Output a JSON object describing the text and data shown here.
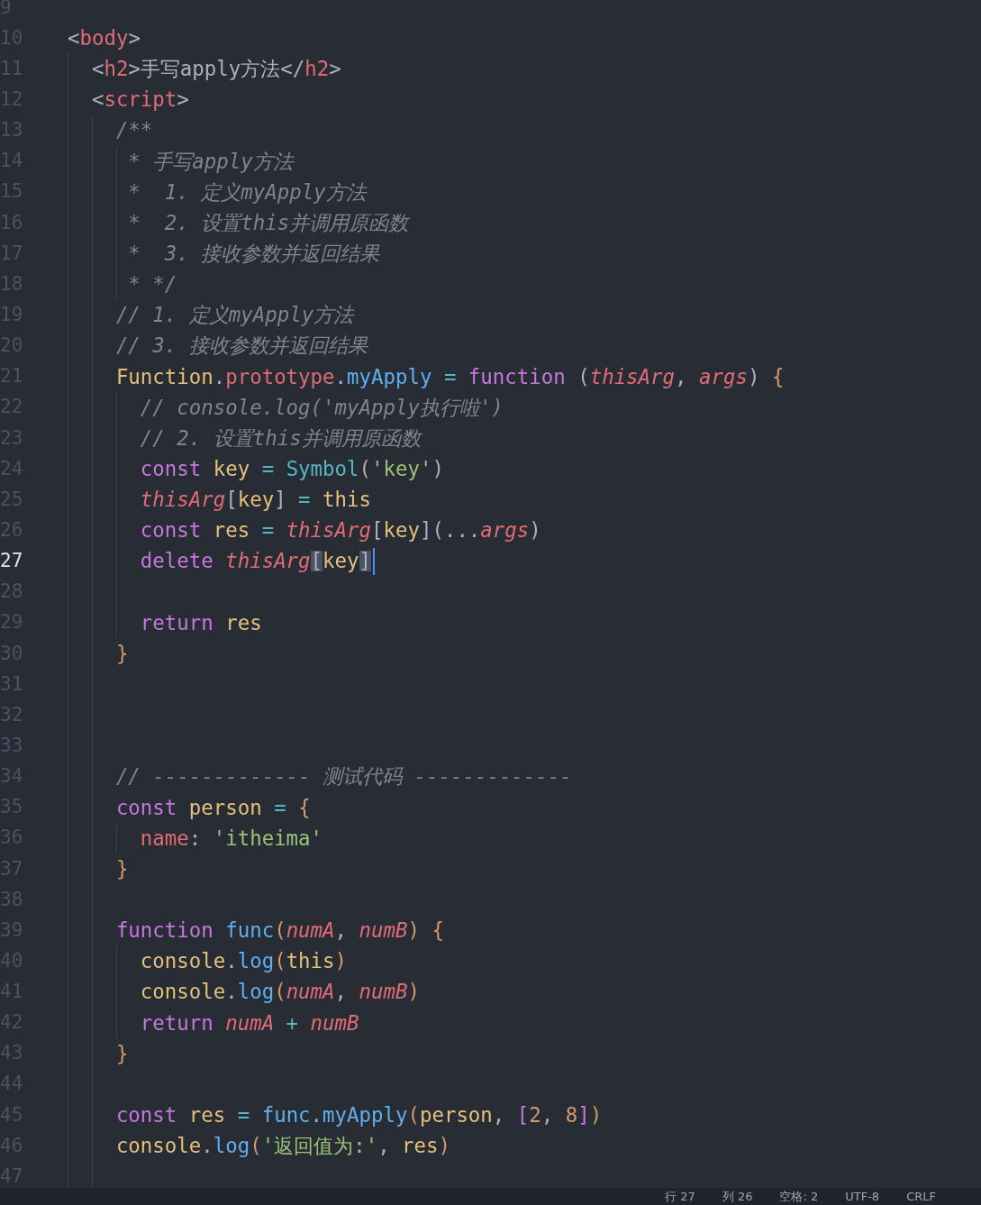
{
  "editor": {
    "lines": [
      {
        "number": "9",
        "current": false
      },
      {
        "number": "10",
        "current": false,
        "tokens": [
          {
            "text": "  <",
            "kind": "punct"
          },
          {
            "text": "body",
            "kind": "tag"
          },
          {
            "text": ">",
            "kind": "punct"
          }
        ]
      },
      {
        "number": "11",
        "current": false,
        "tokens": [
          {
            "text": "    <",
            "kind": "punct"
          },
          {
            "text": "h2",
            "kind": "tag"
          },
          {
            "text": ">",
            "kind": "punct"
          },
          {
            "text": "手写apply方法",
            "kind": "plain"
          },
          {
            "text": "</",
            "kind": "punct"
          },
          {
            "text": "h2",
            "kind": "tag"
          },
          {
            "text": ">",
            "kind": "punct"
          }
        ]
      },
      {
        "number": "12",
        "current": false,
        "tokens": [
          {
            "text": "    <",
            "kind": "punct"
          },
          {
            "text": "script",
            "kind": "tag"
          },
          {
            "text": ">",
            "kind": "punct"
          }
        ]
      },
      {
        "number": "13",
        "current": false,
        "tokens": [
          {
            "text": "      /**",
            "kind": "comment"
          }
        ]
      },
      {
        "number": "14",
        "current": false,
        "tokens": [
          {
            "text": "       * 手写apply方法",
            "kind": "comment"
          }
        ]
      },
      {
        "number": "15",
        "current": false,
        "tokens": [
          {
            "text": "       *  1. 定义myApply方法",
            "kind": "comment"
          }
        ]
      },
      {
        "number": "16",
        "current": false,
        "tokens": [
          {
            "text": "       *  2. 设置this并调用原函数",
            "kind": "comment"
          }
        ]
      },
      {
        "number": "17",
        "current": false,
        "tokens": [
          {
            "text": "       *  3. 接收参数并返回结果",
            "kind": "comment"
          }
        ]
      },
      {
        "number": "18",
        "current": false,
        "tokens": [
          {
            "text": "       * */",
            "kind": "comment"
          }
        ]
      },
      {
        "number": "19",
        "current": false,
        "tokens": [
          {
            "text": "      // 1. 定义myApply方法",
            "kind": "comment"
          }
        ]
      },
      {
        "number": "20",
        "current": false,
        "tokens": [
          {
            "text": "      // 3. 接收参数并返回结果",
            "kind": "comment"
          }
        ]
      },
      {
        "number": "21",
        "current": false,
        "tokens": [
          {
            "text": "      Function",
            "kind": "variable"
          },
          {
            "text": ".",
            "kind": "punct"
          },
          {
            "text": "prototype",
            "kind": "property"
          },
          {
            "text": ".",
            "kind": "punct"
          },
          {
            "text": "myApply",
            "kind": "function"
          },
          {
            "text": " = ",
            "kind": "operator"
          },
          {
            "text": "function",
            "kind": "keyword"
          },
          {
            "text": " (",
            "kind": "punct"
          },
          {
            "text": "thisArg",
            "kind": "param"
          },
          {
            "text": ", ",
            "kind": "punct"
          },
          {
            "text": "args",
            "kind": "param"
          },
          {
            "text": ") ",
            "kind": "punct"
          },
          {
            "text": "{",
            "kind": "bracket"
          }
        ]
      },
      {
        "number": "22",
        "current": false,
        "tokens": [
          {
            "text": "        // console.log('myApply执行啦')",
            "kind": "comment"
          }
        ]
      },
      {
        "number": "23",
        "current": false,
        "tokens": [
          {
            "text": "        // 2. 设置this并调用原函数",
            "kind": "comment"
          }
        ]
      },
      {
        "number": "24",
        "current": false,
        "tokens": [
          {
            "text": "        const",
            "kind": "keyword"
          },
          {
            "text": " key",
            "kind": "variable"
          },
          {
            "text": " = ",
            "kind": "operator"
          },
          {
            "text": "Symbol",
            "kind": "builtin"
          },
          {
            "text": "(",
            "kind": "punct"
          },
          {
            "text": "'key'",
            "kind": "string"
          },
          {
            "text": ")",
            "kind": "punct"
          }
        ]
      },
      {
        "number": "25",
        "current": false,
        "tokens": [
          {
            "text": "        thisArg",
            "kind": "param"
          },
          {
            "text": "[",
            "kind": "punct"
          },
          {
            "text": "key",
            "kind": "variable"
          },
          {
            "text": "]",
            "kind": "punct"
          },
          {
            "text": " = ",
            "kind": "operator"
          },
          {
            "text": "this",
            "kind": "variable"
          }
        ]
      },
      {
        "number": "26",
        "current": false,
        "tokens": [
          {
            "text": "        const",
            "kind": "keyword"
          },
          {
            "text": " res",
            "kind": "variable"
          },
          {
            "text": " = ",
            "kind": "operator"
          },
          {
            "text": "thisArg",
            "kind": "param"
          },
          {
            "text": "[",
            "kind": "punct"
          },
          {
            "text": "key",
            "kind": "variable"
          },
          {
            "text": "](...",
            "kind": "punct"
          },
          {
            "text": "args",
            "kind": "param"
          },
          {
            "text": ")",
            "kind": "punct"
          }
        ]
      },
      {
        "number": "27",
        "current": true,
        "tokens": [
          {
            "text": "        delete ",
            "kind": "keyword"
          },
          {
            "text": "thisArg",
            "kind": "param"
          },
          {
            "text": "[",
            "kind": "match"
          },
          {
            "text": "key",
            "kind": "variable"
          },
          {
            "text": "]",
            "kind": "match"
          }
        ]
      },
      {
        "number": "28",
        "current": false
      },
      {
        "number": "29",
        "current": false,
        "tokens": [
          {
            "text": "        return",
            "kind": "keyword"
          },
          {
            "text": " res",
            "kind": "variable"
          }
        ]
      },
      {
        "number": "30",
        "current": false,
        "tokens": [
          {
            "text": "      }",
            "kind": "bracket"
          }
        ]
      },
      {
        "number": "31",
        "current": false
      },
      {
        "number": "32",
        "current": false
      },
      {
        "number": "33",
        "current": false
      },
      {
        "number": "34",
        "current": false,
        "tokens": [
          {
            "text": "      // ------------- 测试代码 -------------",
            "kind": "comment"
          }
        ]
      },
      {
        "number": "35",
        "current": false,
        "tokens": [
          {
            "text": "      const",
            "kind": "keyword"
          },
          {
            "text": " person",
            "kind": "variable"
          },
          {
            "text": " = ",
            "kind": "operator"
          },
          {
            "text": "{",
            "kind": "bracket"
          }
        ]
      },
      {
        "number": "36",
        "current": false,
        "tokens": [
          {
            "text": "        name",
            "kind": "property"
          },
          {
            "text": ": ",
            "kind": "punct"
          },
          {
            "text": "'itheima'",
            "kind": "string"
          }
        ]
      },
      {
        "number": "37",
        "current": false,
        "tokens": [
          {
            "text": "      }",
            "kind": "bracket"
          }
        ]
      },
      {
        "number": "38",
        "current": false
      },
      {
        "number": "39",
        "current": false,
        "tokens": [
          {
            "text": "      function ",
            "kind": "keyword"
          },
          {
            "text": "func",
            "kind": "function"
          },
          {
            "text": "(",
            "kind": "bracket"
          },
          {
            "text": "numA",
            "kind": "param"
          },
          {
            "text": ", ",
            "kind": "punct"
          },
          {
            "text": "numB",
            "kind": "param"
          },
          {
            "text": ")",
            "kind": "bracket"
          },
          {
            "text": " {",
            "kind": "bracket"
          }
        ]
      },
      {
        "number": "40",
        "current": false,
        "tokens": [
          {
            "text": "        console",
            "kind": "variable"
          },
          {
            "text": ".",
            "kind": "punct"
          },
          {
            "text": "log",
            "kind": "function"
          },
          {
            "text": "(",
            "kind": "bracket"
          },
          {
            "text": "this",
            "kind": "variable"
          },
          {
            "text": ")",
            "kind": "bracket"
          }
        ]
      },
      {
        "number": "41",
        "current": false,
        "tokens": [
          {
            "text": "        console",
            "kind": "variable"
          },
          {
            "text": ".",
            "kind": "punct"
          },
          {
            "text": "log",
            "kind": "function"
          },
          {
            "text": "(",
            "kind": "bracket"
          },
          {
            "text": "numA",
            "kind": "param"
          },
          {
            "text": ", ",
            "kind": "punct"
          },
          {
            "text": "numB",
            "kind": "param"
          },
          {
            "text": ")",
            "kind": "bracket"
          }
        ]
      },
      {
        "number": "42",
        "current": false,
        "tokens": [
          {
            "text": "        return ",
            "kind": "keyword"
          },
          {
            "text": "numA",
            "kind": "param"
          },
          {
            "text": " + ",
            "kind": "operator"
          },
          {
            "text": "numB",
            "kind": "param"
          }
        ]
      },
      {
        "number": "43",
        "current": false,
        "tokens": [
          {
            "text": "      }",
            "kind": "bracket"
          }
        ]
      },
      {
        "number": "44",
        "current": false
      },
      {
        "number": "45",
        "current": false,
        "tokens": [
          {
            "text": "      const",
            "kind": "keyword"
          },
          {
            "text": " res",
            "kind": "variable"
          },
          {
            "text": " = ",
            "kind": "operator"
          },
          {
            "text": "func",
            "kind": "function"
          },
          {
            "text": ".",
            "kind": "punct"
          },
          {
            "text": "myApply",
            "kind": "function"
          },
          {
            "text": "(",
            "kind": "bracket"
          },
          {
            "text": "person",
            "kind": "variable"
          },
          {
            "text": ", ",
            "kind": "punct"
          },
          {
            "text": "[",
            "kind": "bracket2"
          },
          {
            "text": "2",
            "kind": "number"
          },
          {
            "text": ", ",
            "kind": "punct"
          },
          {
            "text": "8",
            "kind": "number"
          },
          {
            "text": "]",
            "kind": "bracket2"
          },
          {
            "text": ")",
            "kind": "bracket"
          }
        ]
      },
      {
        "number": "46",
        "current": false,
        "tokens": [
          {
            "text": "      console",
            "kind": "variable"
          },
          {
            "text": ".",
            "kind": "punct"
          },
          {
            "text": "log",
            "kind": "function"
          },
          {
            "text": "(",
            "kind": "bracket"
          },
          {
            "text": "'返回值为:'",
            "kind": "string"
          },
          {
            "text": ", ",
            "kind": "punct"
          },
          {
            "text": "res",
            "kind": "variable"
          },
          {
            "text": ")",
            "kind": "bracket"
          }
        ]
      },
      {
        "number": "47",
        "current": false
      }
    ]
  },
  "status_bar": {
    "items": [
      "行 27",
      "列 26",
      "空格: 2",
      "UTF-8",
      "CRLF"
    ]
  }
}
